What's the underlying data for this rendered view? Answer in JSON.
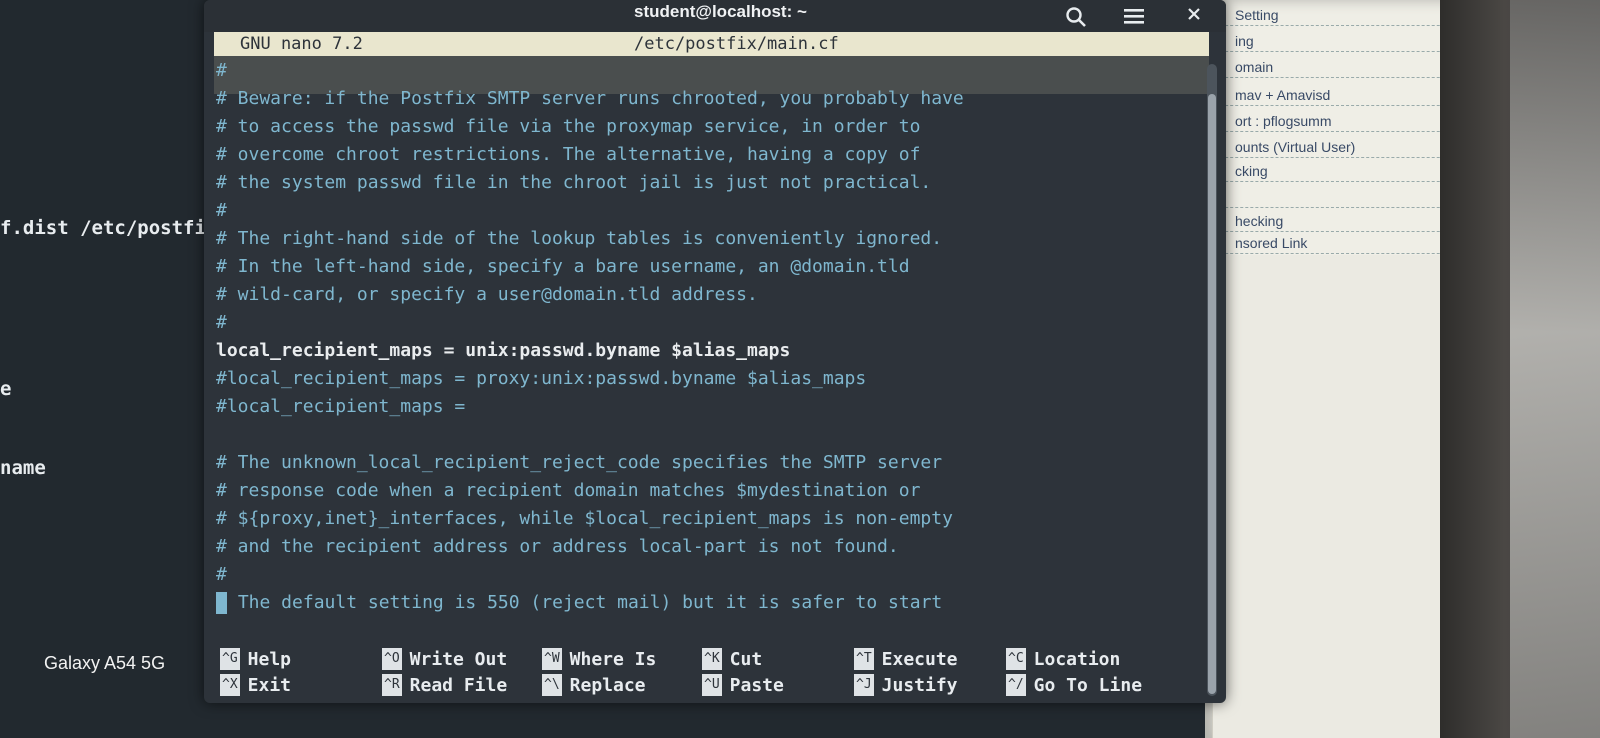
{
  "window": {
    "title": "student@localhost: ~"
  },
  "nano": {
    "version": "GNU nano 7.2",
    "filename": "/etc/postfix/main.cf"
  },
  "background_terminal": {
    "line1": "f.dist /etc/postfi",
    "line2": "e",
    "line3": "name",
    "phone": "Galaxy A54 5G"
  },
  "side_doc": {
    "rows": [
      "Setting",
      "ing",
      "omain",
      "mav + Amavisd",
      "ort : pflogsumm",
      "ounts (Virtual User)",
      "cking",
      "",
      "hecking",
      "nsored Link"
    ]
  },
  "editor": {
    "lines": [
      "#",
      "# Beware: if the Postfix SMTP server runs chrooted, you probably have",
      "# to access the passwd file via the proxymap service, in order to",
      "# overcome chroot restrictions. The alternative, having a copy of",
      "# the system passwd file in the chroot jail is just not practical.",
      "#",
      "# The right-hand side of the lookup tables is conveniently ignored.",
      "# In the left-hand side, specify a bare username, an @domain.tld",
      "# wild-card, or specify a user@domain.tld address.",
      "#",
      "local_recipient_maps = unix:passwd.byname $alias_maps",
      "#local_recipient_maps = proxy:unix:passwd.byname $alias_maps",
      "#local_recipient_maps =",
      "",
      "# The unknown_local_recipient_reject_code specifies the SMTP server",
      "# response code when a recipient domain matches $mydestination or",
      "# ${proxy,inet}_interfaces, while $local_recipient_maps is non-empty",
      "# and the recipient address or address local-part is not found.",
      "#",
      " The default setting is 550 (reject mail) but it is safer to start"
    ]
  },
  "shortcuts": [
    {
      "key": "^G",
      "label": "Help"
    },
    {
      "key": "^O",
      "label": "Write Out"
    },
    {
      "key": "^W",
      "label": "Where Is"
    },
    {
      "key": "^K",
      "label": "Cut"
    },
    {
      "key": "^T",
      "label": "Execute"
    },
    {
      "key": "^C",
      "label": "Location"
    },
    {
      "key": "^X",
      "label": "Exit"
    },
    {
      "key": "^R",
      "label": "Read File"
    },
    {
      "key": "^\\",
      "label": "Replace"
    },
    {
      "key": "^U",
      "label": "Paste"
    },
    {
      "key": "^J",
      "label": "Justify"
    },
    {
      "key": "^/",
      "label": "Go To Line"
    }
  ],
  "colors": {
    "comment": "#7fb7cf",
    "code": "#e9ecee",
    "header_bg": "#e9e6ce",
    "window_bg": "#2d333a"
  },
  "icons": [
    "search-icon",
    "hamburger-menu-icon",
    "close-icon"
  ]
}
